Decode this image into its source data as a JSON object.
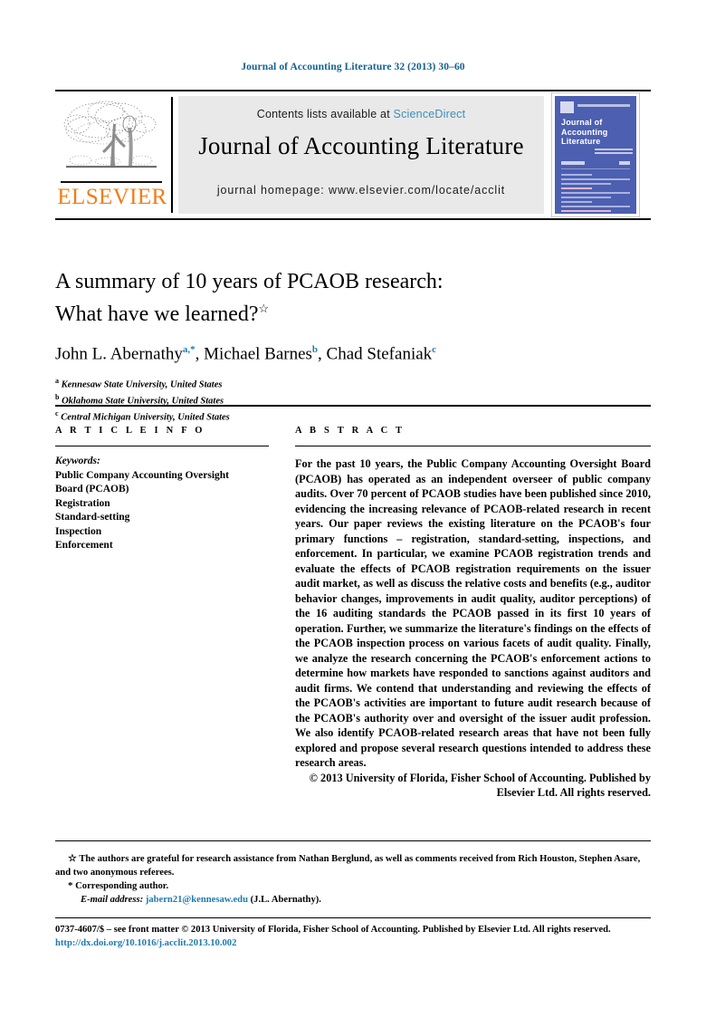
{
  "running_head": "Journal of Accounting Literature 32 (2013) 30–60",
  "header": {
    "contents_prefix": "Contents lists available at ",
    "sciencedirect": "ScienceDirect",
    "journal_title": "Journal of Accounting Literature",
    "homepage": "journal homepage: www.elsevier.com/locate/acclit",
    "publisher_wordmark": "ELSEVIER",
    "cover_title": "Journal of Accounting Literature",
    "accent_link_color": "#3c8dbc",
    "elsevier_orange": "#f07d18",
    "cover_blue": "#4c5fb0"
  },
  "article": {
    "title_line1": "A summary of 10 years of PCAOB research:",
    "title_line2": "What have we learned?",
    "title_star": "☆",
    "authors": [
      {
        "name": "John L. Abernathy",
        "marks": "a,*"
      },
      {
        "name": "Michael Barnes",
        "marks": "b"
      },
      {
        "name": "Chad Stefaniak",
        "marks": "c"
      }
    ],
    "affiliations": [
      {
        "mark": "a",
        "text": "Kennesaw State University, United States"
      },
      {
        "mark": "b",
        "text": "Oklahoma State University, United States"
      },
      {
        "mark": "c",
        "text": "Central Michigan University, United States"
      }
    ]
  },
  "article_info": {
    "heading": "A R T I C L E   I N F O",
    "keywords_label": "Keywords:",
    "keywords": [
      "Public Company Accounting Oversight",
      "Board (PCAOB)",
      "Registration",
      "Standard-setting",
      "Inspection",
      "Enforcement"
    ]
  },
  "abstract": {
    "heading": "A B S T R A C T",
    "body": "For the past 10 years, the Public Company Accounting Oversight Board (PCAOB) has operated as an independent overseer of public company audits. Over 70 percent of PCAOB studies have been published since 2010, evidencing the increasing relevance of PCAOB-related research in recent years. Our paper reviews the existing literature on the PCAOB's four primary functions – registration, standard-setting, inspections, and enforcement. In particular, we examine PCAOB registration trends and evaluate the effects of PCAOB registration requirements on the issuer audit market, as well as discuss the relative costs and benefits (e.g., auditor behavior changes, improvements in audit quality, auditor perceptions) of the 16 auditing standards the PCAOB passed in its first 10 years of operation. Further, we summarize the literature's findings on the effects of the PCAOB inspection process on various facets of audit quality. Finally, we analyze the research concerning the PCAOB's enforcement actions to determine how markets have responded to sanctions against auditors and audit firms. We contend that understanding and reviewing the effects of the PCAOB's activities are important to future audit research because of the PCAOB's authority over and oversight of the issuer audit profession. We also identify PCAOB-related research areas that have not been fully explored and propose several research questions intended to address these research areas.",
    "copyright": "© 2013 University of Florida, Fisher School of Accounting. Published by Elsevier Ltd. All rights reserved."
  },
  "footnotes": {
    "acknowledgement_mark": "☆",
    "acknowledgement": "The authors are grateful for research assistance from Nathan Berglund, as well as comments received from Rich Houston, Stephen Asare, and two anonymous referees.",
    "corresponding_mark": "*",
    "corresponding": "Corresponding author.",
    "email_label": "E-mail address:",
    "email": "jabern21@kennesaw.edu",
    "email_suffix": "(J.L. Abernathy)."
  },
  "frontmatter": {
    "line": "0737-4607/$ – see front matter © 2013 University of Florida, Fisher School of Accounting. Published by Elsevier Ltd. All rights reserved.",
    "doi": "http://dx.doi.org/10.1016/j.acclit.2013.10.002"
  }
}
